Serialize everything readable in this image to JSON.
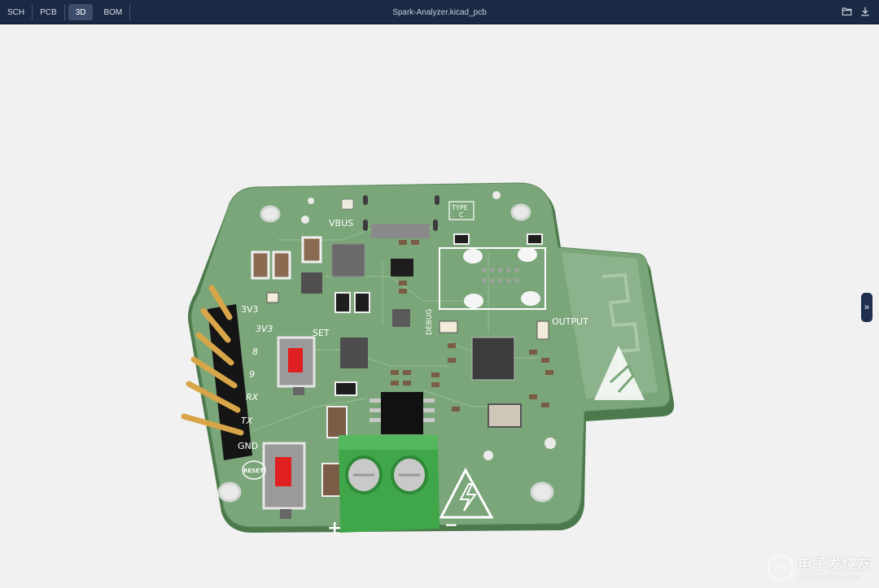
{
  "topbar": {
    "tabs": [
      {
        "label": "SCH",
        "active": false
      },
      {
        "label": "PCB",
        "active": false
      },
      {
        "label": "3D",
        "active": true
      },
      {
        "label": "BOM",
        "active": false
      }
    ],
    "file_title": "Spark-Analyzer.kicad_pcb",
    "icons": [
      "folder-open-icon",
      "download-icon"
    ]
  },
  "board": {
    "silkscreen": {
      "vbus": "VBUS",
      "type_c_line1": "TYPE",
      "type_c_line2": "C",
      "pin_3v3_a": "3V3",
      "pin_3v3_b": "3V3",
      "pin_8": "8",
      "pin_9": "9",
      "pin_rx": "RX",
      "pin_tx": "TX",
      "pin_gnd": "GND",
      "set": "SET",
      "reset": "RESET",
      "debug": "DEBUG",
      "output": "OUTPUT",
      "plus": "+",
      "minus": "−"
    },
    "colors": {
      "pcb_green": "#7aa679",
      "pcb_edge": "#5d8a5c",
      "silk": "#ffffff",
      "terminal": "#3fa64a",
      "header_pin": "#d8a648",
      "button_red": "#e02020"
    }
  },
  "sidebar_toggle_icon": "chevrons-right-icon",
  "watermark": {
    "text": "电子发烧友",
    "subtext": "www.elecfans.com"
  }
}
